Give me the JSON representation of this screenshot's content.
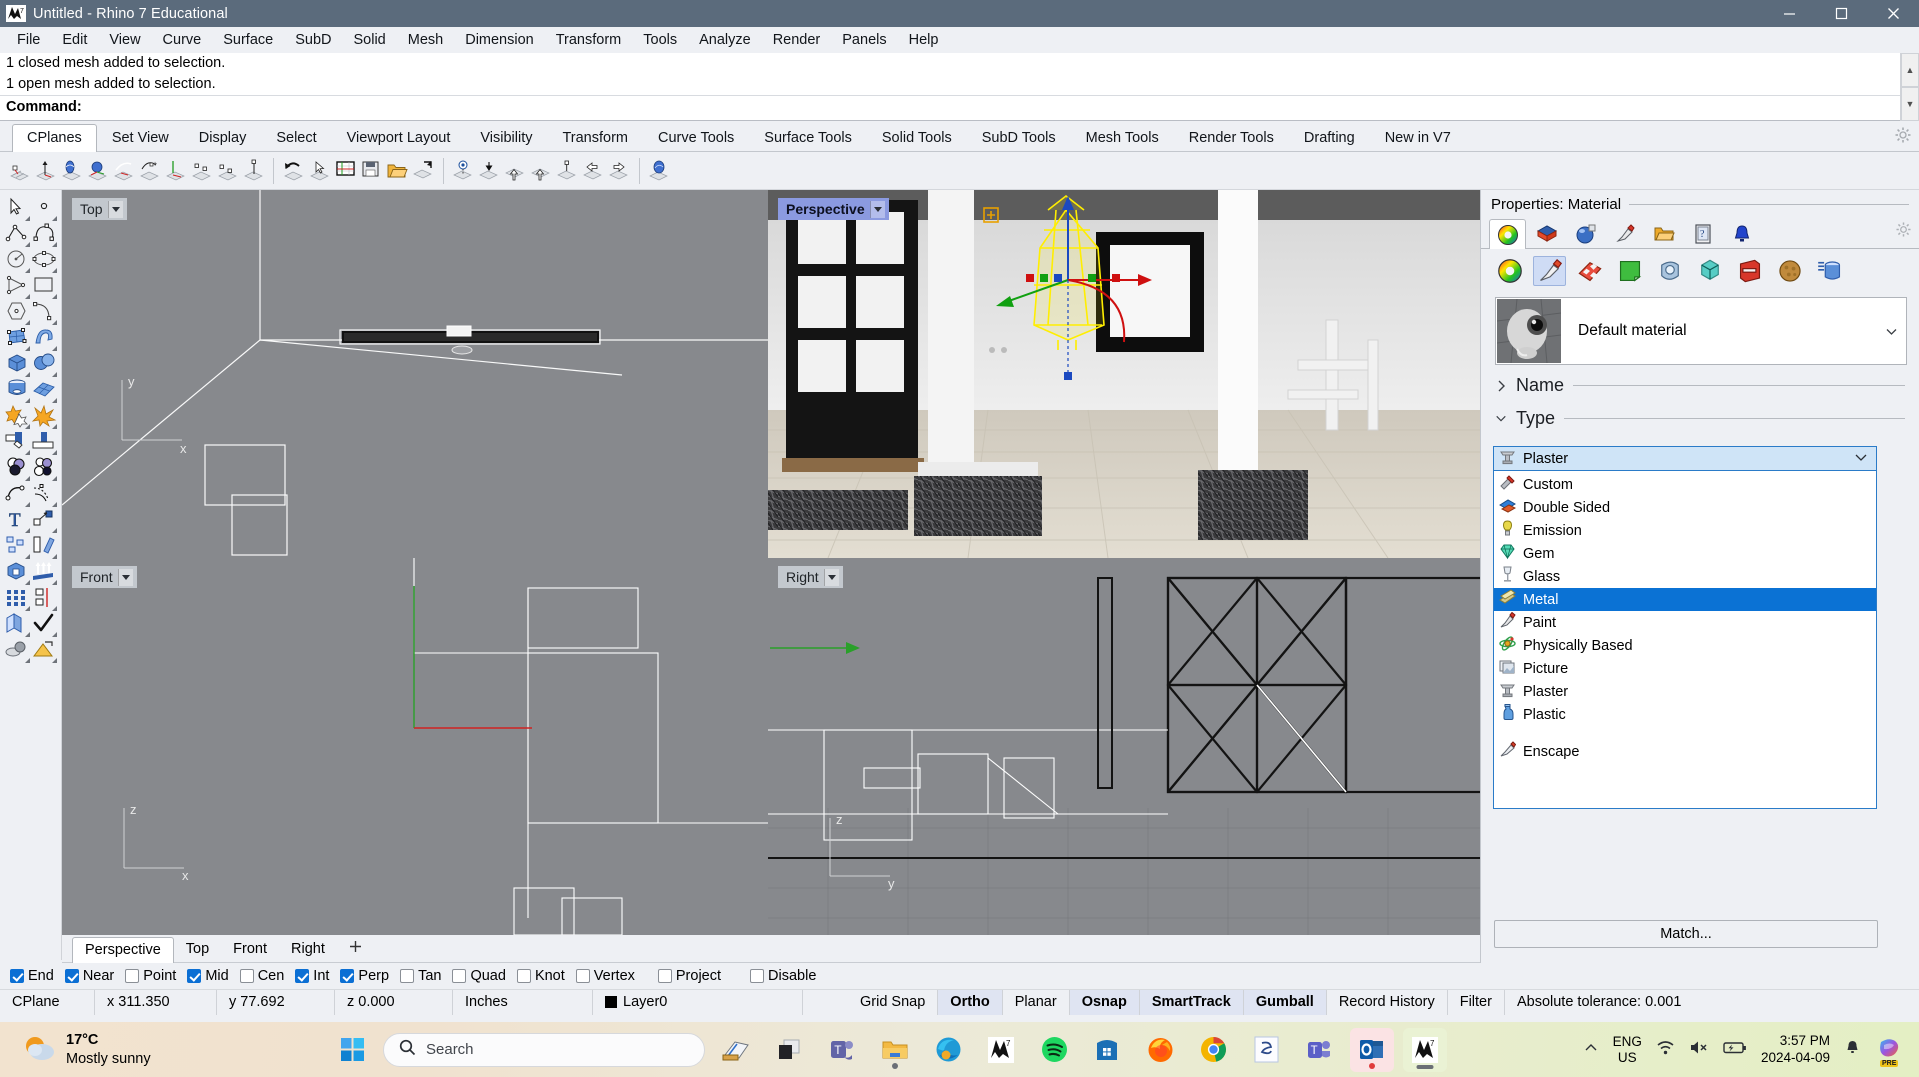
{
  "window": {
    "title": "Untitled - Rhino 7 Educational",
    "app_icon": "rhino-logo-icon",
    "controls": {
      "minimize": "minimize-icon",
      "maximize": "maximize-icon",
      "close": "close-icon"
    }
  },
  "menubar": {
    "items": [
      "File",
      "Edit",
      "View",
      "Curve",
      "Surface",
      "SubD",
      "Solid",
      "Mesh",
      "Dimension",
      "Transform",
      "Tools",
      "Analyze",
      "Render",
      "Panels",
      "Help"
    ]
  },
  "command": {
    "history": [
      "1 closed mesh added to selection.",
      "1 open mesh added to selection."
    ],
    "prompt_label": "Command:",
    "prompt_value": ""
  },
  "toolbar_tabs": {
    "active": "CPlanes",
    "items": [
      "CPlanes",
      "Set View",
      "Display",
      "Select",
      "Viewport Layout",
      "Visibility",
      "Transform",
      "Curve Tools",
      "Surface Tools",
      "Solid Tools",
      "SubD Tools",
      "Mesh Tools",
      "Render Tools",
      "Drafting",
      "New in V7"
    ]
  },
  "icon_toolbar": {
    "groups": [
      [
        "set-cplane-origin-icon",
        "set-cplane-elevation-icon",
        "set-cplane-rotate-icon",
        "set-cplane-object-icon",
        "set-cplane-curve-icon",
        "set-cplane-surface-icon",
        "set-cplane-world-top-icon",
        "set-cplane-3point-icon",
        "set-cplane-perpendicular-icon",
        "set-cplane-view-icon"
      ],
      [
        "undo-cplane-change-icon",
        "cplane-pick-icon",
        "named-cplanes-icon",
        "save-cplane-icon",
        "restore-cplane-icon",
        "cplane-to-view-icon"
      ],
      [
        "cplane-show-grid-icon",
        "cplane-next-icon",
        "cplane-previous-icon",
        "cplane-universal-icon",
        "cplane-align-icon",
        "cplane-left-icon",
        "cplane-right-icon"
      ],
      [
        "cplane-object-props-icon"
      ]
    ]
  },
  "left_palette": {
    "tools": [
      [
        "select-objects-icon",
        "point-object-icon"
      ],
      [
        "polyline-icon",
        "control-point-curve-icon"
      ],
      [
        "circle-icon",
        "ellipse-icon"
      ],
      [
        "polygon-triangle-icon",
        "rectangle-icon"
      ],
      [
        "polygon-hexagon-icon",
        "arc-icon"
      ],
      [
        "surface-from-points-icon",
        "surface-sweep-icon"
      ],
      [
        "box-icon",
        "sphere-icon"
      ],
      [
        "cylinder-icon",
        "surface-mesh-icon"
      ],
      [
        "boolean-union-star-icon",
        "explode-icon"
      ],
      [
        "trim-icon",
        "split-icon"
      ],
      [
        "boolean-operations-icon",
        "boolean-difference-icon"
      ],
      [
        "fillet-curve-icon",
        "offset-curve-icon"
      ],
      [
        "text-object-icon",
        "dimension-icon"
      ],
      [
        "array-icon",
        "rotate-copy-icon"
      ],
      [
        "cap-planar-holes-icon",
        "extrude-icon"
      ],
      [
        "rectangular-array-icon",
        "mirror-icon"
      ],
      [
        "layers-icon",
        "check-object-icon"
      ],
      [
        "shade-icon",
        "render-icon"
      ]
    ]
  },
  "viewports": [
    {
      "name": "Top",
      "active": false,
      "position": "top-left"
    },
    {
      "name": "Perspective",
      "active": true,
      "position": "top-right"
    },
    {
      "name": "Front",
      "active": false,
      "position": "bottom-left"
    },
    {
      "name": "Right",
      "active": false,
      "position": "bottom-right"
    }
  ],
  "viewport_tabs": {
    "active": "Perspective",
    "items": [
      "Perspective",
      "Top",
      "Front",
      "Right"
    ],
    "add_label": "add-viewport-icon"
  },
  "osnap": {
    "items": [
      {
        "label": "End",
        "checked": true
      },
      {
        "label": "Near",
        "checked": true
      },
      {
        "label": "Point",
        "checked": false
      },
      {
        "label": "Mid",
        "checked": true
      },
      {
        "label": "Cen",
        "checked": false
      },
      {
        "label": "Int",
        "checked": true
      },
      {
        "label": "Perp",
        "checked": true
      },
      {
        "label": "Tan",
        "checked": false
      },
      {
        "label": "Quad",
        "checked": false
      },
      {
        "label": "Knot",
        "checked": false
      },
      {
        "label": "Vertex",
        "checked": false
      },
      {
        "label": "Project",
        "checked": false
      },
      {
        "label": "Disable",
        "checked": false
      }
    ]
  },
  "statusbar": {
    "cplane_label": "CPlane",
    "x": "x 311.350",
    "y": "y 77.692",
    "z": "z 0.000",
    "units": "Inches",
    "layer": "Layer0",
    "layer_color": "#000000",
    "toggles": [
      {
        "label": "Grid Snap",
        "on": false
      },
      {
        "label": "Ortho",
        "on": true
      },
      {
        "label": "Planar",
        "on": false
      },
      {
        "label": "Osnap",
        "on": true
      },
      {
        "label": "SmartTrack",
        "on": true
      },
      {
        "label": "Gumball",
        "on": true
      },
      {
        "label": "Record History",
        "on": false
      },
      {
        "label": "Filter",
        "on": false
      }
    ],
    "tolerance": "Absolute tolerance: 0.001"
  },
  "properties": {
    "title": "Properties: Material",
    "panel_tabs": [
      {
        "icon": "color-wheel-icon",
        "active": true
      },
      {
        "icon": "layers-book-icon",
        "active": false
      },
      {
        "icon": "render-sphere-icon",
        "active": false
      },
      {
        "icon": "material-brush-icon",
        "active": false
      },
      {
        "icon": "folder-open-icon",
        "active": false
      },
      {
        "icon": "help-page-icon",
        "active": false
      },
      {
        "icon": "light-bell-icon",
        "active": false
      }
    ],
    "panel_settings_icon": "gear-icon",
    "material_buttons": [
      {
        "icon": "color-wheel-icon",
        "selected": false
      },
      {
        "icon": "material-brush-icon",
        "selected": true
      },
      {
        "icon": "texture-checker-icon",
        "selected": false
      },
      {
        "icon": "green-page-icon",
        "selected": false
      },
      {
        "icon": "environment-icon",
        "selected": false
      },
      {
        "icon": "cube-transparent-icon",
        "selected": false
      },
      {
        "icon": "red-toolbox-icon",
        "selected": false
      },
      {
        "icon": "bump-sphere-icon",
        "selected": false
      },
      {
        "icon": "cylinder-layers-icon",
        "selected": false
      }
    ],
    "current_material": {
      "name": "Default material",
      "thumb_icon": "material-preview-icon",
      "expander_icon": "chevron-down-icon"
    },
    "sections": [
      {
        "label": "Name",
        "expanded": false
      },
      {
        "label": "Type",
        "expanded": true
      }
    ],
    "type_combo": {
      "value": "Plaster",
      "icon": "plaster-icon",
      "chevron": "chevron-down-icon",
      "open": true
    },
    "type_options": [
      {
        "label": "Custom",
        "icon": "custom-tools-icon",
        "highlighted": false
      },
      {
        "label": "Double Sided",
        "icon": "double-sided-icon",
        "highlighted": false
      },
      {
        "label": "Emission",
        "icon": "emission-bulb-icon",
        "highlighted": false
      },
      {
        "label": "Gem",
        "icon": "gem-icon",
        "highlighted": false
      },
      {
        "label": "Glass",
        "icon": "glass-icon",
        "highlighted": false
      },
      {
        "label": "Metal",
        "icon": "metal-icon",
        "highlighted": true
      },
      {
        "label": "Paint",
        "icon": "paint-icon",
        "highlighted": false
      },
      {
        "label": "Physically Based",
        "icon": "physically-based-icon",
        "highlighted": false
      },
      {
        "label": "Picture",
        "icon": "picture-icon",
        "highlighted": false
      },
      {
        "label": "Plaster",
        "icon": "plaster-icon",
        "highlighted": false
      },
      {
        "label": "Plastic",
        "icon": "plastic-icon",
        "highlighted": false
      },
      {
        "label": "",
        "icon": "separator",
        "highlighted": false
      },
      {
        "label": "Enscape",
        "icon": "enscape-icon",
        "highlighted": false
      }
    ],
    "match_button": "Match..."
  },
  "taskbar": {
    "weather": {
      "temperature": "17°C",
      "condition": "Mostly sunny",
      "icon": "weather-partly-sunny-icon"
    },
    "start_icon": "windows-start-icon",
    "search": {
      "placeholder": "Search",
      "icon": "search-icon"
    },
    "apps": [
      "copilot-widget-icon",
      "task-view-icon",
      "teams-chat-icon",
      "file-explorer-icon",
      "edge-icon",
      "rhino-icon",
      "spotify-icon",
      "microsoft-store-icon",
      "firefox-icon",
      "chrome-icon",
      "shapediver-icon",
      "teams-icon",
      "outlook-icon",
      "rhino-active-icon"
    ],
    "tray": {
      "overflow_icon": "chevron-up-icon",
      "language": {
        "line1": "ENG",
        "line2": "US"
      },
      "wifi_icon": "wifi-icon",
      "volume_icon": "volume-muted-icon",
      "battery_icon": "battery-charging-icon",
      "time": "3:57 PM",
      "date": "2024-04-09",
      "notifications_icon": "bell-icon",
      "copilot_icon": "copilot-preview-icon",
      "copilot_badge": "PRE"
    }
  }
}
